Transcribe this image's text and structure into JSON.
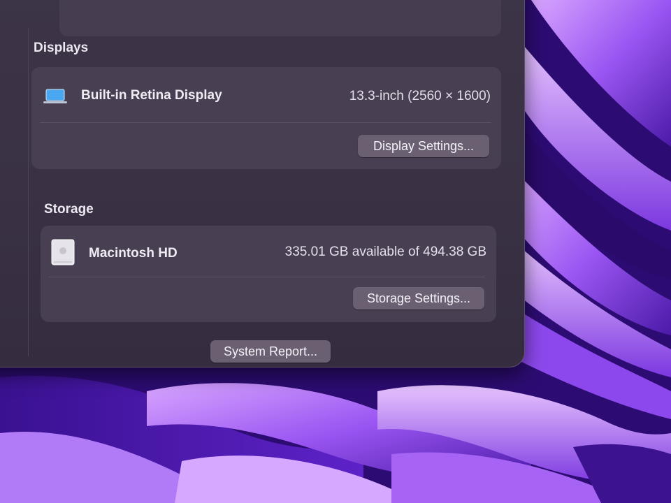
{
  "displays": {
    "section_title": "Displays",
    "device_name": "Built-in Retina Display",
    "device_spec": "13.3-inch (2560 × 1600)",
    "settings_button": "Display Settings..."
  },
  "storage": {
    "section_title": "Storage",
    "volume_name": "Macintosh HD",
    "capacity_text": "335.01 GB available of 494.38 GB",
    "settings_button": "Storage Settings..."
  },
  "footer": {
    "system_report_button": "System Report..."
  },
  "icons": {
    "display": "laptop-icon",
    "storage": "hard-drive-icon"
  },
  "colors": {
    "window_bg": "#3a3145",
    "card_bg": "#483f52",
    "button_bg": "#6a6072",
    "wallpaper_accent": "#8b4ef0",
    "laptop_screen": "#4aa8f0"
  }
}
